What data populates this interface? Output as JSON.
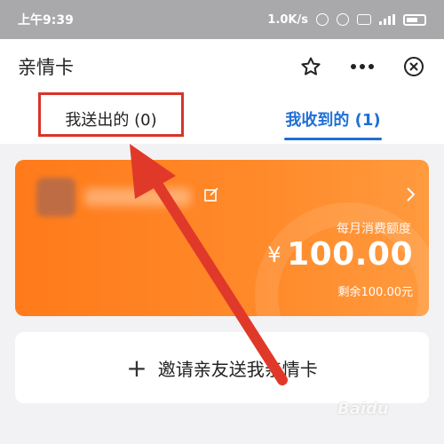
{
  "status_bar": {
    "time": "上午9:39",
    "speed": "1.0K/s"
  },
  "header": {
    "title": "亲情卡"
  },
  "tabs": [
    {
      "label": "我送出的 (0)",
      "active": false
    },
    {
      "label": "我收到的 (1)",
      "active": true
    }
  ],
  "card": {
    "monthly_label": "每月消费额度",
    "currency_symbol": "¥",
    "amount": "100.00",
    "remaining": "剩余100.00元"
  },
  "invite": {
    "plus": "+",
    "label": "邀请亲友送我亲情卡"
  },
  "watermark": "Baidu",
  "colors": {
    "accent_blue": "#1f6fd6",
    "card_orange": "#ff7a1a",
    "annotation_red": "#d9332a"
  }
}
